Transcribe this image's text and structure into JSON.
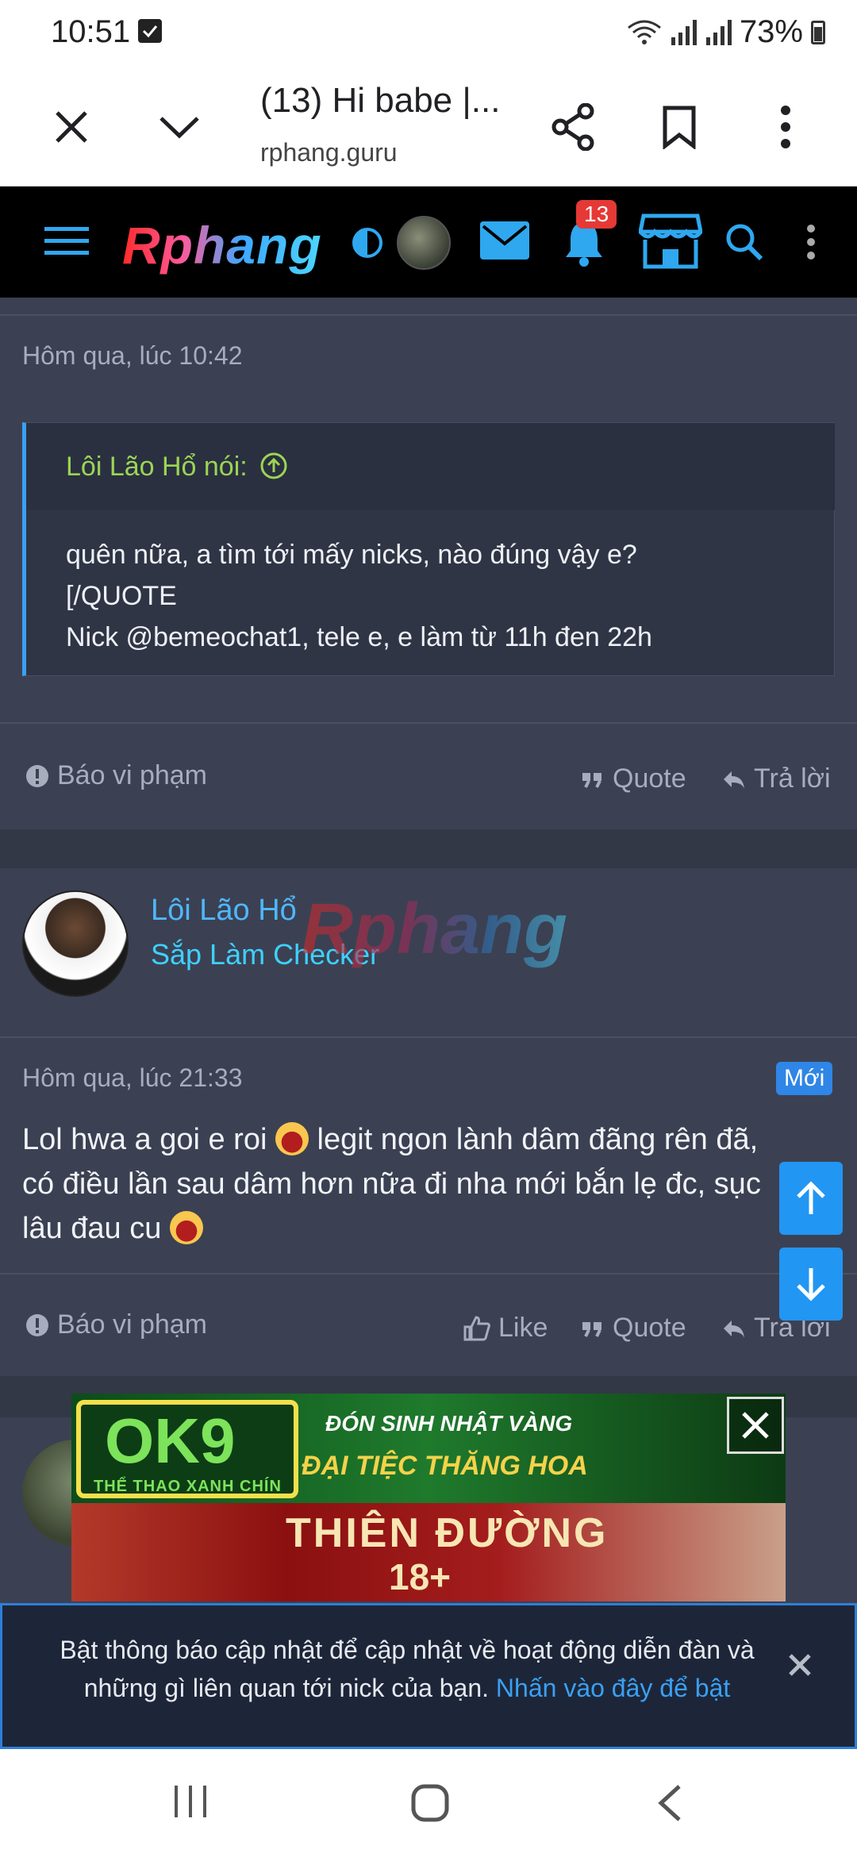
{
  "status_bar": {
    "time": "10:51",
    "battery": "73%"
  },
  "browser": {
    "title": "(13) Hi babe |...",
    "url": "rphang.guru"
  },
  "site": {
    "logo_text": "Rphang",
    "notification_count": "13"
  },
  "post1": {
    "timestamp": "Hôm qua, lúc 10:42",
    "quote_author": "Lôi Lão Hổ nói:",
    "quote_lines": [
      "quên nữa, a tìm tới mấy nicks, nào đúng vậy e?",
      "[/QUOTE",
      "Nick @bemeochat1, tele e, e làm từ 11h đen 22h"
    ],
    "report_label": "Báo vi phạm",
    "quote_label": "Quote",
    "reply_label": "Trả lời"
  },
  "post2": {
    "author_name": "Lôi Lão Hổ",
    "author_title": "Sắp Làm Checker",
    "watermark": "Rphang",
    "timestamp": "Hôm qua, lúc 21:33",
    "new_badge": "Mới",
    "text_part1": "Lol hwa a goi e roi ",
    "text_part2": " legit ngon lành dâm đãng rên đã, có điều lần sau dâm hơn nữa đi nha mới bắn lẹ đc, sục lâu đau cu ",
    "report_label": "Báo vi phạm",
    "like_label": "Like",
    "quote_label": "Quote",
    "reply_label": "Trả lời"
  },
  "ad": {
    "brand": "OK9",
    "brand_sub": "THỂ THAO XANH CHÍN",
    "headline1": "ĐÓN SINH NHẬT VÀNG",
    "headline2": "ĐẠI TIỆC THĂNG HOA",
    "banner2_title": "THIÊN ĐƯỜNG",
    "banner2_age": "18+"
  },
  "notice": {
    "text": "Bật thông báo cập nhật để cập nhật về hoạt động diễn đàn và những gì liên quan tới nick của bạn. ",
    "link": "Nhấn vào đây để bật"
  },
  "colors": {
    "accent": "#2196f3",
    "background": "#323846",
    "quote_author": "#9bd554"
  }
}
